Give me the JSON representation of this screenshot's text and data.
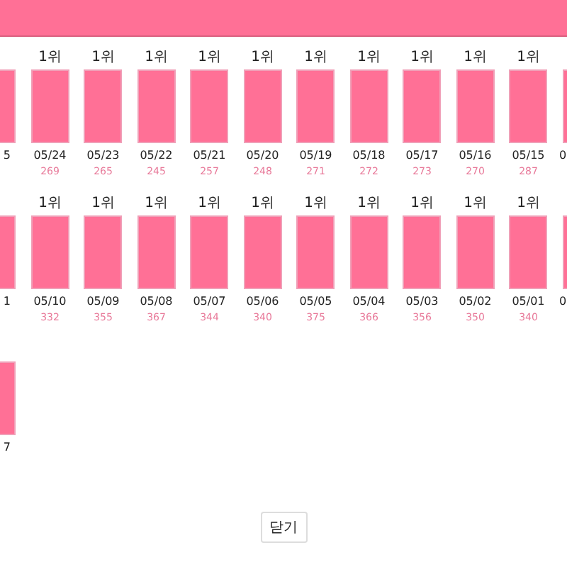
{
  "rows": [
    {
      "items": [
        {
          "kind": "cut_left",
          "date": "5"
        },
        {
          "kind": "full",
          "rank": "1위",
          "date": "05/24",
          "count": "269"
        },
        {
          "kind": "full",
          "rank": "1위",
          "date": "05/23",
          "count": "265"
        },
        {
          "kind": "full",
          "rank": "1위",
          "date": "05/22",
          "count": "245"
        },
        {
          "kind": "full",
          "rank": "1위",
          "date": "05/21",
          "count": "257"
        },
        {
          "kind": "full",
          "rank": "1위",
          "date": "05/20",
          "count": "248"
        },
        {
          "kind": "full",
          "rank": "1위",
          "date": "05/19",
          "count": "271"
        },
        {
          "kind": "full",
          "rank": "1위",
          "date": "05/18",
          "count": "272"
        },
        {
          "kind": "full",
          "rank": "1위",
          "date": "05/17",
          "count": "273"
        },
        {
          "kind": "full",
          "rank": "1위",
          "date": "05/16",
          "count": "270"
        },
        {
          "kind": "full",
          "rank": "1위",
          "date": "05/15",
          "count": "287"
        },
        {
          "kind": "cut_right",
          "date": "0"
        }
      ]
    },
    {
      "items": [
        {
          "kind": "cut_left",
          "date": "1"
        },
        {
          "kind": "full",
          "rank": "1위",
          "date": "05/10",
          "count": "332"
        },
        {
          "kind": "full",
          "rank": "1위",
          "date": "05/09",
          "count": "355"
        },
        {
          "kind": "full",
          "rank": "1위",
          "date": "05/08",
          "count": "367"
        },
        {
          "kind": "full",
          "rank": "1위",
          "date": "05/07",
          "count": "344"
        },
        {
          "kind": "full",
          "rank": "1위",
          "date": "05/06",
          "count": "340"
        },
        {
          "kind": "full",
          "rank": "1위",
          "date": "05/05",
          "count": "375"
        },
        {
          "kind": "full",
          "rank": "1위",
          "date": "05/04",
          "count": "366"
        },
        {
          "kind": "full",
          "rank": "1위",
          "date": "05/03",
          "count": "356"
        },
        {
          "kind": "full",
          "rank": "1위",
          "date": "05/02",
          "count": "350"
        },
        {
          "kind": "full",
          "rank": "1위",
          "date": "05/01",
          "count": "340"
        },
        {
          "kind": "cut_right",
          "date": "0"
        }
      ]
    },
    {
      "items": [
        {
          "kind": "cut_left",
          "date": "7"
        }
      ]
    }
  ],
  "close_button": "닫기"
}
